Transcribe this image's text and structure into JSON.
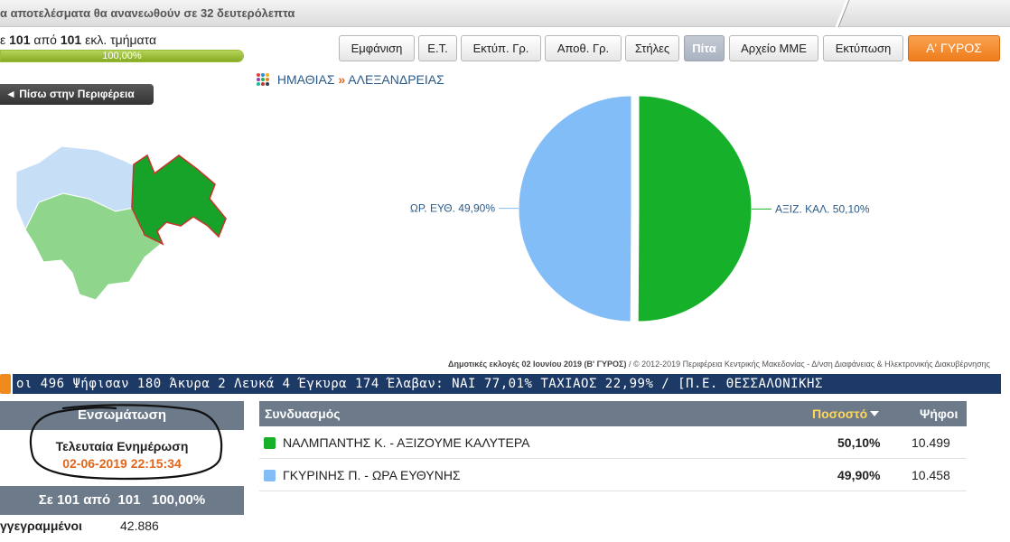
{
  "topbar": {
    "refresh_text": "α αποτελέσματα θα ανανεωθούν σε 32 δευτερόλεπτα"
  },
  "progress": {
    "prefix": "ε",
    "counted": "101",
    "middle": "από",
    "total": "101",
    "suffix": "εκλ. τμήματα",
    "percent_text": "100,00%",
    "fraction": 1.0
  },
  "toolbar": {
    "buttons": [
      {
        "label": "Εμφάνιση"
      },
      {
        "label": "Ε.Τ."
      },
      {
        "label": "Εκτύπ. Γρ."
      },
      {
        "label": "Αποθ. Γρ."
      },
      {
        "label": "Στήλες"
      },
      {
        "label": "Πίτα"
      },
      {
        "label": "Αρχείο ΜΜΕ"
      },
      {
        "label": "Εκτύπωση"
      },
      {
        "label": "Α' ΓΥΡΟΣ"
      }
    ],
    "active_index": 5
  },
  "back_button": {
    "label": "◄ Πίσω στην Περιφέρεια"
  },
  "breadcrumb": {
    "level1": "ΗΜΑΘΙΑΣ",
    "separator": "»",
    "level2": "ΑΛΕΞΑΝΔΡΕΙΑΣ"
  },
  "colors": {
    "green": "#17b02a",
    "blue": "#82bdf7",
    "orange": "#ef7c1c",
    "header_gray": "#6d7a8a",
    "ticker_navy": "#1d3a66"
  },
  "chart_data": {
    "type": "pie",
    "slices": [
      {
        "label": "ΑΞΙΖ. ΚΑΛ. 50,10%",
        "value": 50.1,
        "color": "#17b02a"
      },
      {
        "label": "ΩΡ. ΕΥΘ. 49,90%",
        "value": 49.9,
        "color": "#82bdf7"
      }
    ]
  },
  "footer": {
    "election": "Δημοτικές εκλογές 02 Ιουνίου 2019 (Β' ΓΥΡΟΣ)",
    "credit": " / © 2012-2019 Περιφέρεια Κεντρικής Μακεδονίας - Δ/νση Διαφάνειας & Ηλεκτρονικής Διακυβέρνησης"
  },
  "ticker": {
    "text": "οι 496  Ψήφισαν 180  Άκυρα 2  Λευκά 4  Έγκυρα 174  Έλαβαν: ΝΑΙ 77,01%  ΤΑΧΙΑΟΣ 22,99%  /  [Π.Ε. ΘΕΣΣΑΛΟΝΙΚΗΣ"
  },
  "left_panel": {
    "header": "Ενσωμάτωση",
    "last_update_label": "Τελευταία Ενημέρωση",
    "last_update_time": "02-06-2019 22:15:34",
    "summary": "Σε 101 από  101   100,00%",
    "registered_label": "γγεγραμμένοι",
    "registered_value": "42.886"
  },
  "results": {
    "headers": {
      "combination": "Συνδυασμός",
      "percent": "Ποσοστό",
      "votes": "Ψήφοι"
    },
    "rows": [
      {
        "name": "ΝΑΛΜΠΑΝΤΗΣ Κ. - ΑΞΙΖΟΥΜΕ ΚΑΛΥΤΕΡΑ",
        "percent": "50,10%",
        "votes": "10.499",
        "color": "#17b02a"
      },
      {
        "name": "ΓΚΥΡΙΝΗΣ Π. - ΩΡΑ ΕΥΘΥΝΗΣ",
        "percent": "49,90%",
        "votes": "10.458",
        "color": "#82bdf7"
      }
    ]
  }
}
